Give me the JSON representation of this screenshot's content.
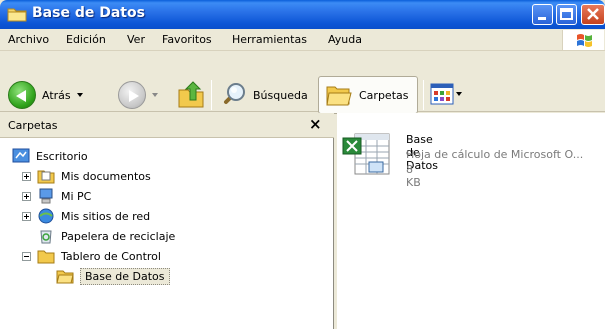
{
  "window": {
    "title": "Base de Datos"
  },
  "menu": [
    "Archivo",
    "Edición",
    "Ver",
    "Favoritos",
    "Herramientas",
    "Ayuda"
  ],
  "toolbar": {
    "back_label": "Atrás",
    "search_label": "Búsqueda",
    "folders_label": "Carpetas"
  },
  "folder_pane": {
    "title": "Carpetas",
    "close_glyph": "×",
    "tree": [
      {
        "label": "Escritorio",
        "icon": "desktop-icon"
      },
      {
        "label": "Mis documentos",
        "icon": "documents-folder-icon"
      },
      {
        "label": "Mi PC",
        "icon": "my-computer-icon"
      },
      {
        "label": "Mis sitios de red",
        "icon": "network-places-icon"
      },
      {
        "label": "Papelera de reciclaje",
        "icon": "recycle-bin-icon"
      },
      {
        "label": "Tablero de Control",
        "icon": "folder-icon"
      },
      {
        "label": "Base de Datos",
        "icon": "folder-open-icon"
      }
    ]
  },
  "content": {
    "file": {
      "name": "Base de Datos",
      "type": "Hoja de cálculo de Microsoft O...",
      "size": "8 KB",
      "icon": "excel-file-icon"
    }
  },
  "colors": {
    "titlebar": "#2a72e8",
    "chrome": "#ece9d8",
    "back_green": "#2fa21a"
  }
}
